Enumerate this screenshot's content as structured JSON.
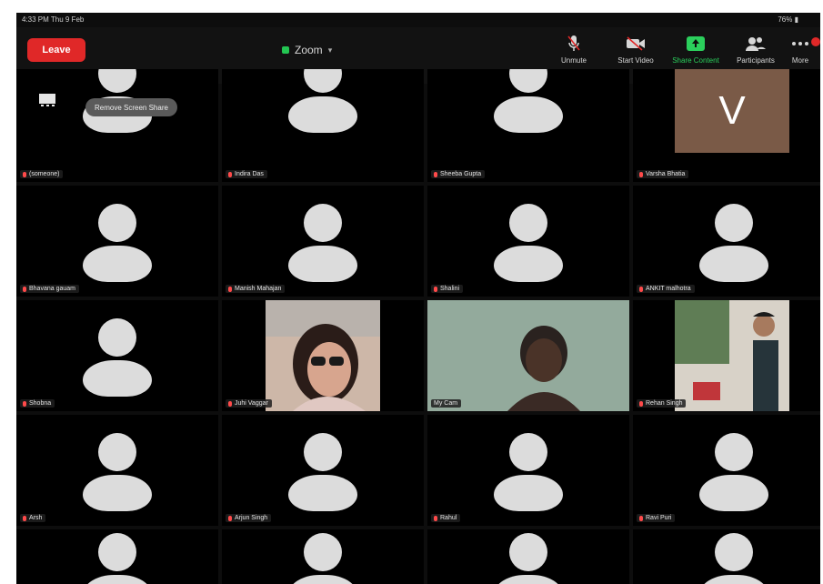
{
  "status_bar": {
    "time": "4:33 PM Thu 9 Feb",
    "battery": "76% ▮"
  },
  "toolbar": {
    "leave_label": "Leave",
    "meeting_title": "Zoom",
    "controls": [
      {
        "label": "Unmute",
        "icon": "microphone-muted-icon"
      },
      {
        "label": "Start Video",
        "icon": "video-camera-icon"
      },
      {
        "label": "Share Content",
        "icon": "share-screen-icon"
      },
      {
        "label": "Participants",
        "icon": "participants-icon"
      },
      {
        "label": "More",
        "icon": "more-icon"
      }
    ]
  },
  "share_prompt": "Remove Screen Share",
  "participants": [
    {
      "name": "(someone)",
      "type": "avatar"
    },
    {
      "name": "Indira Das",
      "type": "avatar"
    },
    {
      "name": "Sheeba Gupta",
      "type": "avatar"
    },
    {
      "name": "Varsha Bhatia",
      "type": "initial",
      "initial": "V"
    },
    {
      "name": "Bhavana gauam",
      "type": "avatar"
    },
    {
      "name": "Manish Mahajan",
      "type": "avatar"
    },
    {
      "name": "Shalini",
      "type": "avatar"
    },
    {
      "name": "ANKIT malhotra",
      "type": "avatar"
    },
    {
      "name": "Shobna",
      "type": "avatar"
    },
    {
      "name": "Juhi Vaggar",
      "type": "video"
    },
    {
      "name": "My Cam",
      "type": "video"
    },
    {
      "name": "Rehan Singh",
      "type": "video"
    },
    {
      "name": "Arsh",
      "type": "avatar"
    },
    {
      "name": "Arjun Singh",
      "type": "avatar"
    },
    {
      "name": "Rahul",
      "type": "avatar"
    },
    {
      "name": "Ravi Puri",
      "type": "avatar"
    },
    {
      "name": "",
      "type": "avatar"
    },
    {
      "name": "",
      "type": "avatar"
    },
    {
      "name": "",
      "type": "avatar"
    },
    {
      "name": "",
      "type": "avatar"
    }
  ],
  "colors": {
    "leave": "#e02828",
    "active_speaker": "#5ad36a",
    "share": "#2bcf5c"
  }
}
